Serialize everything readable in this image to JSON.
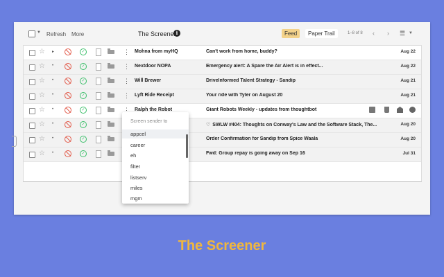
{
  "toolbar": {
    "refresh_label": "Refresh",
    "more_label": "More",
    "title": "The Screener",
    "info_icon": "i",
    "feed_label": "Feed",
    "paper_trail_label": "Paper Trail",
    "count": "1–8 of 8"
  },
  "rows": [
    {
      "sender": "Mohna from myHQ",
      "subject": "Can't work from home, buddy?",
      "date": "Aug 22",
      "state": "unread"
    },
    {
      "sender": "Nextdoor NOPA",
      "subject": "Emergency alert: A Spare the Air Alert is in effect...",
      "date": "Aug 22",
      "state": "read"
    },
    {
      "sender": "Will Brewer",
      "subject": "DriveInformed Talent Strategy - Sandip",
      "date": "Aug 21",
      "state": "read"
    },
    {
      "sender": "Lyft Ride Receipt",
      "subject": "Your ride with Tyler on August 20",
      "date": "Aug 21",
      "state": "read"
    },
    {
      "sender": "Ralph the Robot",
      "subject": "Giant Robots Weekly - updates from thoughtbot",
      "date": "",
      "state": "unread"
    },
    {
      "sender": "",
      "subject": "SWLW #404: Thoughts on Conway's Law and the Software Stack, The...",
      "date": "Aug 20",
      "state": "read"
    },
    {
      "sender": "",
      "subject": "Order Confirmation for Sandip from Spice Waala",
      "date": "Aug 20",
      "state": "read"
    },
    {
      "sender": "",
      "subject": "Fwd: Group repay is going away on Sep 16",
      "date": "Jul 31",
      "state": "read"
    }
  ],
  "dropdown": {
    "header": "Screen sender to",
    "items": [
      "appcel",
      "career",
      "eh",
      "filter",
      "listserv",
      "miles",
      "mgm"
    ]
  },
  "caption": "The Screener",
  "colors": {
    "background": "#6a7fe0",
    "feed_button": "#f3d28a",
    "caption": "#f0b73d",
    "block": "#e25b4b",
    "ok": "#3cbf6a"
  }
}
